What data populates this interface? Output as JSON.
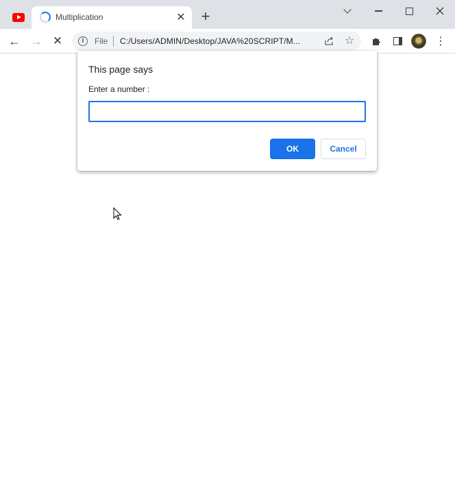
{
  "tabs": [
    {
      "icon": "youtube-icon",
      "active": false
    },
    {
      "title": "Multiplication",
      "icon": "loading-spinner-icon",
      "active": true
    }
  ],
  "tab_close_glyph": "✕",
  "new_tab_glyph": "+",
  "toolbar": {
    "back_glyph": "←",
    "forward_glyph": "→",
    "stop_glyph": "✕",
    "extensions_glyph": "✱",
    "menu_glyph": "⋮"
  },
  "address_bar": {
    "scheme_label": "File",
    "url": "C:/Users/ADMIN/Desktop/JAVA%20SCRIPT/M...",
    "star_glyph": "☆"
  },
  "dialog": {
    "title": "This page says",
    "message": "Enter a number :",
    "input_value": "",
    "ok_label": "OK",
    "cancel_label": "Cancel"
  },
  "colors": {
    "accent": "#1a73e8",
    "tabstrip": "#dee1e6",
    "omnibox": "#f1f3f4",
    "youtube": "#ff0000"
  }
}
